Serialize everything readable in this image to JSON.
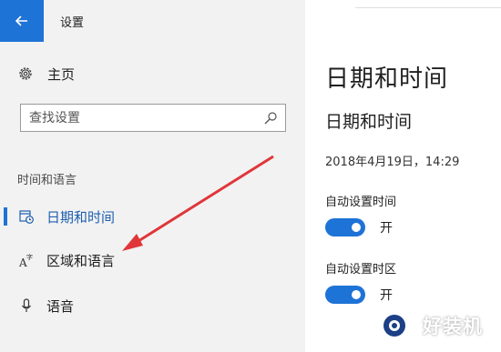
{
  "window": {
    "title": "设置"
  },
  "sidebar": {
    "home_label": "主页",
    "search_placeholder": "查找设置",
    "section_title": "时间和语言",
    "items": [
      {
        "label": "日期和时间",
        "icon": "calendar-clock-icon",
        "active": true
      },
      {
        "label": "区域和语言",
        "icon": "language-icon",
        "active": false
      },
      {
        "label": "语音",
        "icon": "microphone-icon",
        "active": false
      }
    ]
  },
  "main": {
    "page_title": "日期和时间",
    "section_title": "日期和时间",
    "current_datetime": "2018年4月19日，14:29",
    "settings": [
      {
        "label": "自动设置时间",
        "state": "开",
        "on": true
      },
      {
        "label": "自动设置时区",
        "state": "开",
        "on": true
      }
    ]
  },
  "colors": {
    "accent": "#1e73d6",
    "arrow": "#e0363a"
  },
  "watermark": {
    "text": "好装机"
  }
}
